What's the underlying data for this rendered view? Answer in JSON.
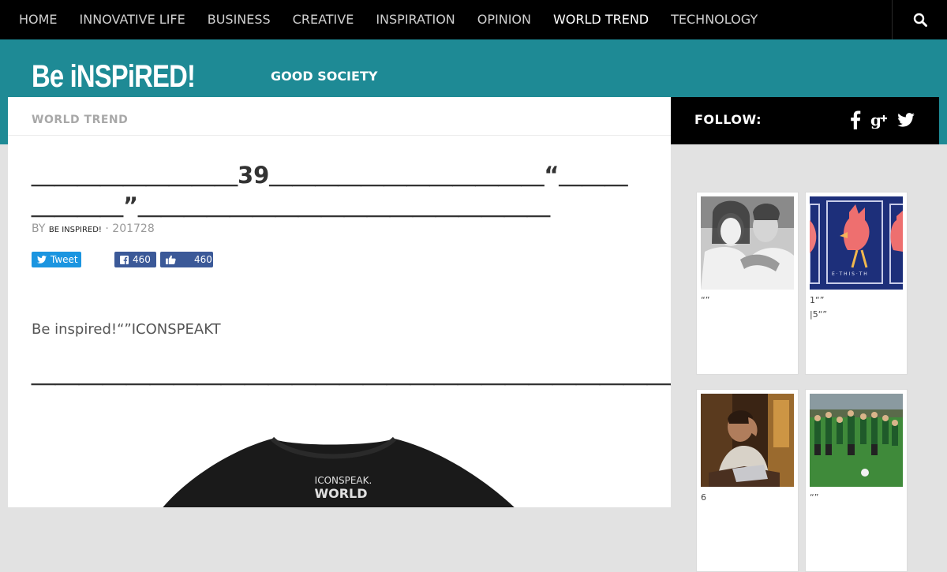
{
  "top_nav": {
    "items": [
      "HOME",
      "INNOVATIVE LIFE",
      "BUSINESS",
      "CREATIVE",
      "INSPIRATION",
      "OPINION",
      "WORLD TREND",
      "TECHNOLOGY"
    ],
    "active": "WORLD TREND"
  },
  "header": {
    "logo_text": "Be iNSPiRED!",
    "subnav_label": "GOOD SOCIETY"
  },
  "article": {
    "category": "WORLD TREND",
    "title": "＿＿＿＿＿＿＿＿＿39＿＿＿＿＿＿＿＿＿＿＿＿“＿＿＿＿＿＿＿”＿＿＿＿＿＿＿＿＿＿＿＿＿＿＿＿＿＿",
    "byline": {
      "by": "BY",
      "author": "BE INSPIRED!",
      "separator": "·",
      "date": "201728"
    },
    "share": {
      "tweet_label": "Tweet",
      "facebook_count": "460",
      "like_count": "460"
    },
    "lead": "Be inspired!“”ICONSPEAKT",
    "subheading": "＿＿＿＿＿＿＿＿＿＿＿＿＿＿＿＿＿＿＿＿＿＿＿＿＿＿＿＿＿＿",
    "shirt_text": [
      "ICONSPEAK.",
      "WORLD"
    ]
  },
  "sidebar": {
    "follow_label": "FOLLOW:",
    "social_icons": [
      "facebook-icon",
      "google-plus-icon",
      "twitter-icon"
    ],
    "cards": [
      {
        "caption": "“”"
      },
      {
        "caption": "1“”\n|5“”"
      },
      {
        "caption": "6"
      },
      {
        "caption": "“”"
      }
    ]
  },
  "colors": {
    "teal": "#1e8a95",
    "nav_bg": "#000000",
    "twitter": "#1b95e0",
    "facebook": "#3b5998"
  }
}
